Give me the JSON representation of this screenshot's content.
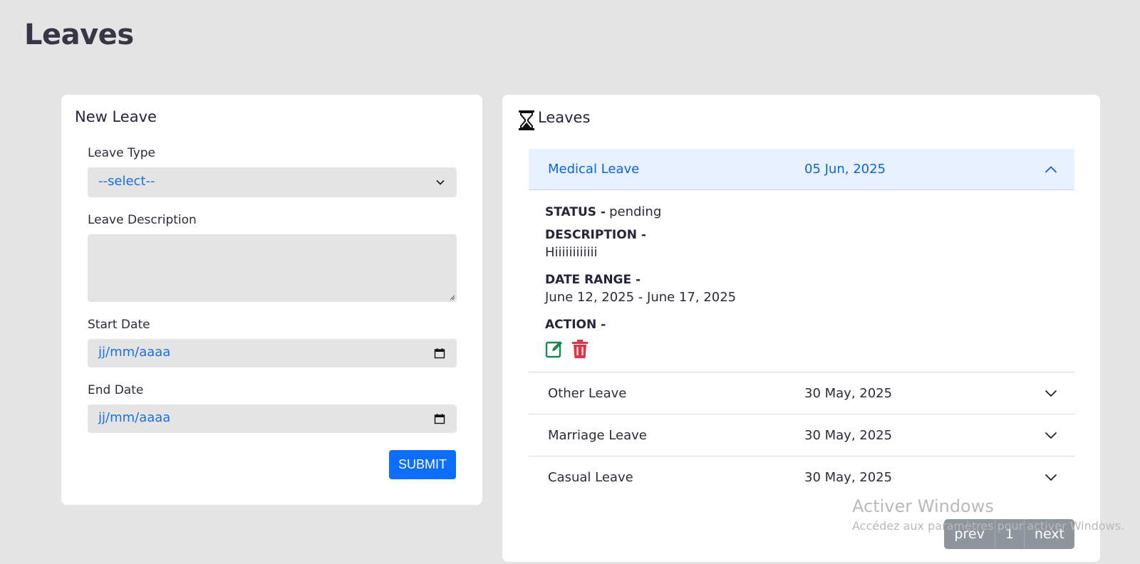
{
  "page": {
    "title": "Leaves"
  },
  "new_leave": {
    "title": "New Leave",
    "leave_type_label": "Leave Type",
    "leave_type_value": "--select--",
    "description_label": "Leave Description",
    "start_label": "Start Date",
    "start_value": "jj/mm/aaaa",
    "end_label": "End Date",
    "end_value": "jj/mm/aaaa",
    "submit_label": "SUBMIT"
  },
  "leaves_list": {
    "title": "Leaves",
    "expanded": {
      "type": "Medical Leave",
      "date": "05 Jun, 2025",
      "status_label": "STATUS -",
      "status_value": "pending",
      "description_label": "DESCRIPTION -",
      "description_value": "Hiiiiiiiiiiii",
      "date_range_label": "DATE RANGE -",
      "date_range_value": "June 12, 2025 - June 17, 2025",
      "action_label": "ACTION -"
    },
    "items": [
      {
        "type": "Other Leave",
        "date": "30 May, 2025"
      },
      {
        "type": "Marriage Leave",
        "date": "30 May, 2025"
      },
      {
        "type": "Casual Leave",
        "date": "30 May, 2025"
      }
    ],
    "pagination": {
      "prev": "prev",
      "page": "1",
      "next": "next"
    }
  },
  "watermark": {
    "line1": "Activer Windows",
    "line2": "Accédez aux paramètres pour activer Windows."
  },
  "colors": {
    "accent": "#0d6efd",
    "edit": "#198754",
    "delete": "#dc3545"
  }
}
